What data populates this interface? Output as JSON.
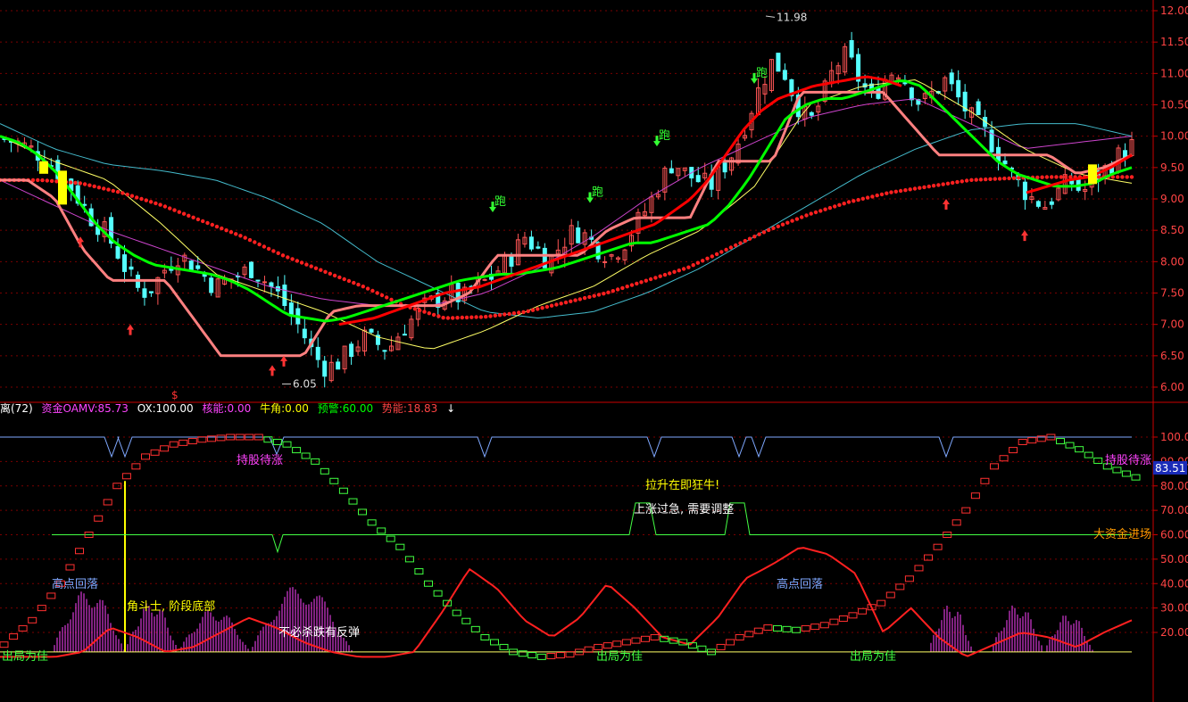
{
  "colors": {
    "background": "#000000",
    "grid": "#7a0000",
    "axis": "#cc0000",
    "candle_up": "#ff5555",
    "candle_down": "#55ffff",
    "ma_green": "#00ff00",
    "ma_red": "#ff0000",
    "ma_pink": "#ff8080",
    "dots": "#ff2020",
    "ma_magenta": "#cc44cc",
    "ma_cyan": "#44bbcc",
    "ma_yellow": "#ffff66",
    "osc_steps_up": "#ff3030",
    "osc_steps_down": "#40ff40",
    "blue_line": "#7fa8ff",
    "level_line": "#44ff44",
    "mag_hist": "#ff44ff"
  },
  "indicator_bar": {
    "name": "离(72)",
    "items": [
      {
        "label": "资金OAMV:85.73",
        "color": "#ff44ff"
      },
      {
        "label": "OX:100.00",
        "color": "#ffffff"
      },
      {
        "label": "核能:0.00",
        "color": "#ff44ff"
      },
      {
        "label": "牛角:0.00",
        "color": "#ffff00"
      },
      {
        "label": "预警:60.00",
        "color": "#00ff00"
      },
      {
        "label": "势能:18.83",
        "color": "#ff4444"
      }
    ],
    "marker": "↓"
  },
  "price_axis": [
    "12.00",
    "11.50",
    "11.00",
    "10.50",
    "10.00",
    "9.50",
    "9.00",
    "8.50",
    "8.00",
    "7.50",
    "7.00",
    "6.50",
    "6.00"
  ],
  "osc_axis": [
    "100.00",
    "90.00",
    "80.00",
    "70.00",
    "60.00",
    "50.00",
    "40.00",
    "30.00",
    "20.00"
  ],
  "current_value_badge": "83.51",
  "price_annotations": {
    "high": "11.98",
    "low": "6.05",
    "dollar_mark": "$"
  },
  "signals": {
    "run_label": "跑"
  },
  "osc_annotations": [
    {
      "key": "hold1",
      "text": "持股待涨",
      "color": "#ff44ff"
    },
    {
      "key": "hold2",
      "text": "持股待涨",
      "color": "#ff44ff"
    },
    {
      "key": "bull",
      "text": "拉升在即狂牛!",
      "color": "#ffff00"
    },
    {
      "key": "overheat",
      "text": "上涨过急, 需要调整",
      "color": "#ffffff"
    },
    {
      "key": "bigmoney",
      "text": "大资金进场",
      "color": "#ff9900"
    },
    {
      "key": "highfall1",
      "text": "高点回落",
      "color": "#7fa8ff"
    },
    {
      "key": "highfall2",
      "text": "高点回落",
      "color": "#7fa8ff"
    },
    {
      "key": "fighter",
      "text": "角斗士, 阶段底部",
      "color": "#ffff00"
    },
    {
      "key": "rebound",
      "text": "不必杀跌有反弹",
      "color": "#ffffff"
    },
    {
      "key": "exit1",
      "text": "出局为佳",
      "color": "#40ff40"
    },
    {
      "key": "exit2",
      "text": "出局为佳",
      "color": "#40ff40"
    },
    {
      "key": "exit3",
      "text": "出局为佳",
      "color": "#40ff40"
    }
  ],
  "chart_data": [
    {
      "type": "candlestick",
      "title": "",
      "ylim": [
        5.9,
        12.05
      ],
      "y_ticks": [
        6.0,
        6.5,
        7.0,
        7.5,
        8.0,
        8.5,
        9.0,
        9.5,
        10.0,
        10.5,
        11.0,
        11.5,
        12.0
      ],
      "max_label": 11.98,
      "min_label": 6.05,
      "grid": true,
      "series_note": "daily candles approximated; overlaid moving averages",
      "close_path": [
        9.95,
        9.9,
        9.8,
        9.7,
        9.5,
        9.3,
        9.0,
        8.7,
        8.5,
        8.2,
        7.8,
        7.5,
        7.6,
        7.9,
        8.1,
        8.0,
        7.8,
        7.6,
        7.7,
        7.8,
        7.9,
        7.7,
        7.5,
        7.2,
        6.9,
        6.5,
        6.3,
        6.4,
        6.6,
        6.8,
        6.7,
        6.6,
        6.9,
        7.1,
        7.3,
        7.4,
        7.5,
        7.4,
        7.6,
        7.7,
        7.9,
        8.1,
        8.4,
        8.2,
        8.0,
        8.3,
        8.5,
        8.4,
        8.2,
        8.1,
        8.3,
        8.6,
        8.9,
        9.3,
        9.6,
        9.4,
        9.3,
        9.2,
        9.5,
        9.8,
        10.3,
        10.8,
        11.2,
        11.0,
        10.5,
        10.2,
        10.6,
        11.1,
        11.3,
        10.9,
        10.6,
        10.9,
        11.1,
        10.8,
        10.5,
        10.7,
        10.9,
        10.6,
        10.3,
        10.1,
        9.8,
        9.5,
        9.2,
        9.0,
        8.9,
        9.1,
        9.3,
        9.1,
        9.3,
        9.5,
        9.7,
        9.85
      ],
      "ma_lines": [
        {
          "color": "green",
          "values": [
            10.0,
            9.9,
            9.7,
            9.4,
            9.0,
            8.6,
            8.3,
            8.1,
            7.95,
            7.9,
            7.85,
            7.8,
            7.7,
            7.55,
            7.35,
            7.15,
            7.1,
            7.05,
            7.1,
            7.2,
            7.3,
            7.4,
            7.5,
            7.6,
            7.7,
            7.75,
            7.8,
            7.8,
            7.85,
            7.9,
            8.0,
            8.1,
            8.2,
            8.3,
            8.3,
            8.4,
            8.5,
            8.6,
            8.9,
            9.3,
            9.8,
            10.3,
            10.5,
            10.6,
            10.6,
            10.7,
            10.8,
            10.9,
            10.8,
            10.5,
            10.2,
            9.9,
            9.6,
            9.4,
            9.3,
            9.2,
            9.2,
            9.25,
            9.4,
            9.5
          ]
        },
        {
          "color": "red",
          "values": [
            7.0,
            7.05,
            7.1,
            7.2,
            7.3,
            7.4,
            7.5,
            7.55,
            7.6,
            7.7,
            7.8,
            7.9,
            8.0,
            8.1,
            8.2,
            8.3,
            8.4,
            8.5,
            8.6,
            8.8,
            9.0,
            9.3,
            9.7,
            10.1,
            10.4,
            10.6,
            10.7,
            10.8,
            10.85,
            10.9,
            10.95,
            10.9,
            10.8
          ]
        },
        {
          "color": "pink",
          "values": [
            9.3,
            9.3,
            9.0,
            8.2,
            7.7,
            7.7,
            7.7,
            7.1,
            6.5,
            6.5,
            6.5,
            6.5,
            7.2,
            7.3,
            7.3,
            7.3,
            7.3,
            7.5,
            8.1,
            8.1,
            8.1,
            8.1,
            8.5,
            8.7,
            8.7,
            8.7,
            9.6,
            9.6,
            9.6,
            10.7,
            10.7,
            10.7,
            10.7,
            10.2,
            9.7,
            9.7,
            9.7,
            9.7,
            9.7,
            9.4,
            9.5,
            9.7
          ]
        },
        {
          "color": "dots",
          "values": [
            9.3,
            9.3,
            9.25,
            9.1,
            8.9,
            8.65,
            8.4,
            8.1,
            7.85,
            7.6,
            7.3,
            7.1,
            7.12,
            7.2,
            7.35,
            7.5,
            7.7,
            7.9,
            8.2,
            8.5,
            8.75,
            8.95,
            9.1,
            9.2,
            9.3,
            9.33,
            9.35,
            9.35,
            9.35
          ]
        }
      ]
    },
    {
      "type": "line",
      "title": "",
      "ylim": [
        10,
        105
      ],
      "y_ticks": [
        20,
        30,
        40,
        50,
        60,
        70,
        80,
        90,
        100
      ],
      "series": [
        {
          "name": "OX",
          "values": [
            15,
            25,
            40,
            60,
            80,
            92,
            97,
            99,
            100,
            100,
            97,
            90,
            78,
            65,
            55,
            40,
            28,
            18,
            12,
            10,
            11,
            14,
            16,
            18,
            16,
            12,
            18,
            22,
            21,
            23,
            27,
            32,
            42,
            55,
            70,
            88,
            98,
            100,
            95,
            88,
            83.51
          ]
        },
        {
          "name": "势能",
          "values": [
            10,
            10,
            10,
            12,
            22,
            18,
            12,
            14,
            20,
            26,
            22,
            16,
            12,
            10,
            10,
            12,
            28,
            46,
            38,
            25,
            18,
            26,
            40,
            30,
            18,
            15,
            26,
            42,
            48,
            55,
            52,
            44,
            20,
            30,
            18,
            10,
            15,
            20,
            18,
            14,
            20,
            25
          ]
        },
        {
          "name": "预警",
          "values": [
            60,
            60,
            60,
            60,
            60,
            55,
            60,
            60,
            60,
            60,
            60,
            60,
            60,
            60,
            60,
            60,
            60,
            60,
            60,
            72,
            60,
            60,
            72,
            60,
            60,
            60,
            60,
            60,
            60,
            60
          ]
        },
        {
          "name": "资金OAMV",
          "values": [
            100,
            100,
            92,
            100,
            100,
            100,
            100,
            100,
            100,
            92,
            100,
            100,
            92,
            100,
            100,
            92,
            100,
            100,
            100,
            100,
            92,
            100,
            100,
            100,
            100
          ]
        }
      ]
    }
  ]
}
